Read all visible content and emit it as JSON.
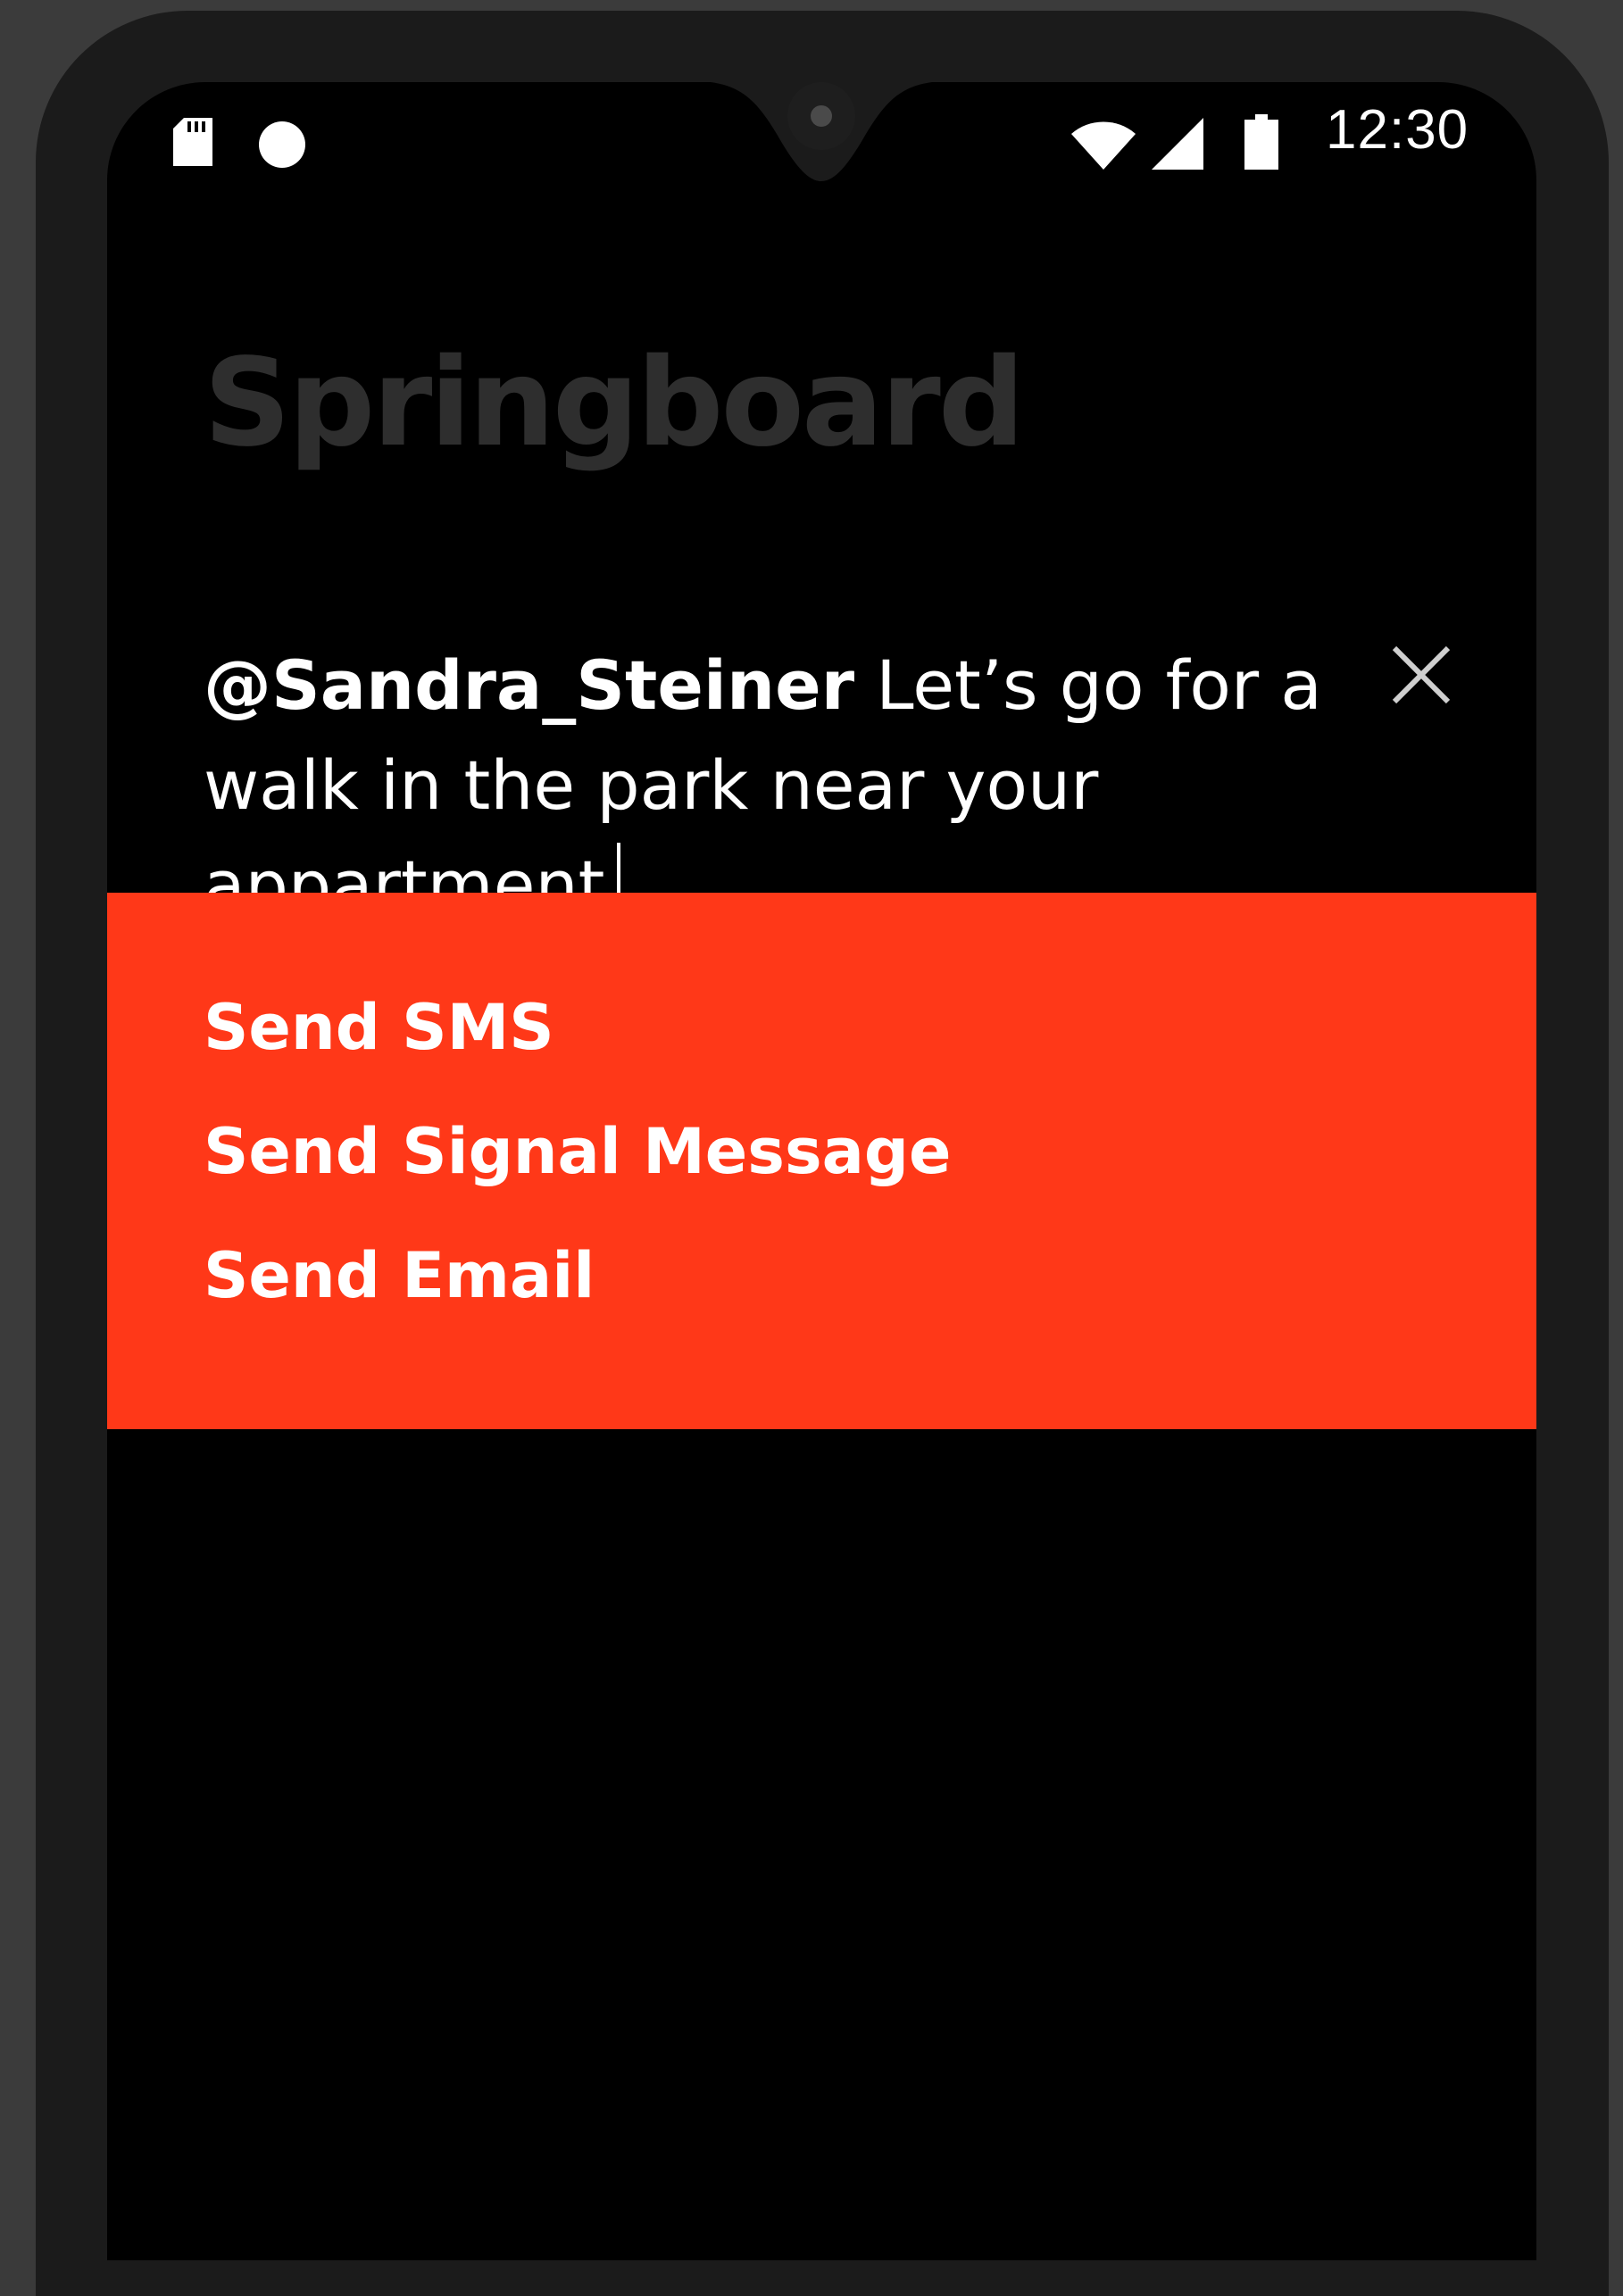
{
  "status_bar": {
    "time": "12:30",
    "icons": [
      "sd-card-icon",
      "notification-dot-icon",
      "wifi-icon",
      "cell-signal-icon",
      "battery-icon"
    ]
  },
  "app": {
    "title": "Springboard"
  },
  "composer": {
    "mention": "@Sandra_Steiner",
    "message": " Let’s go for a walk in the park near your appartment"
  },
  "actions": [
    {
      "label": "Send SMS"
    },
    {
      "label": "Send Signal Message"
    },
    {
      "label": "Send Email"
    }
  ],
  "colors": {
    "accent": "#ff3818",
    "title": "#2e2e2e",
    "background": "#000000",
    "frame": "#1b1b1b"
  }
}
